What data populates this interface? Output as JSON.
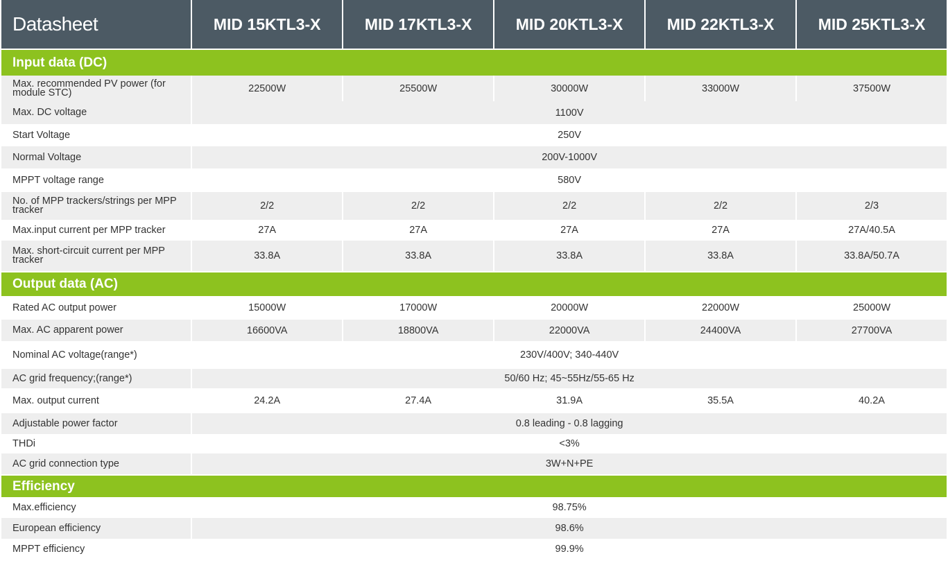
{
  "header": {
    "title": "Datasheet",
    "models": [
      "MID 15KTL3-X",
      "MID 17KTL3-X",
      "MID 20KTL3-X",
      "MID 22KTL3-X",
      "MID 25KTL3-X"
    ]
  },
  "sections": {
    "input": {
      "title": "Input data (DC)",
      "rows": {
        "r1": {
          "label": "Max. recommended PV power (for module STC)",
          "values": [
            "22500W",
            "25500W",
            "30000W",
            "33000W",
            "37500W"
          ]
        },
        "r2": {
          "label": "Max. DC voltage",
          "value": "1100V"
        },
        "r3": {
          "label": "Start Voltage",
          "value": "250V"
        },
        "r4": {
          "label": "Normal Voltage",
          "value": "200V-1000V"
        },
        "r5": {
          "label": "MPPT voltage range",
          "value": "580V"
        },
        "r6": {
          "label": "No. of MPP trackers/strings per MPP tracker",
          "values": [
            "2/2",
            "2/2",
            "2/2",
            "2/2",
            "2/3"
          ]
        },
        "r7": {
          "label": "Max.input current per MPP tracker",
          "values": [
            "27A",
            "27A",
            "27A",
            "27A",
            "27A/40.5A"
          ]
        },
        "r8": {
          "label": "Max. short-circuit current per MPP tracker",
          "values": [
            "33.8A",
            "33.8A",
            "33.8A",
            "33.8A",
            "33.8A/50.7A"
          ]
        }
      }
    },
    "output": {
      "title": "Output data (AC)",
      "rows": {
        "r1": {
          "label": "Rated AC output power",
          "values": [
            "15000W",
            "17000W",
            "20000W",
            "22000W",
            "25000W"
          ]
        },
        "r2": {
          "label": "Max. AC apparent power",
          "values": [
            "16600VA",
            "18800VA",
            "22000VA",
            "24400VA",
            "27700VA"
          ]
        },
        "r3": {
          "label": "Nominal AC voltage(range*)",
          "value": "230V/400V; 340-440V"
        },
        "r4": {
          "label": "AC grid frequency;(range*)",
          "value": "50/60 Hz; 45~55Hz/55-65 Hz"
        },
        "r5": {
          "label": "Max. output current",
          "values": [
            "24.2A",
            "27.4A",
            "31.9A",
            "35.5A",
            "40.2A"
          ]
        },
        "r6": {
          "label": "Adjustable power factor",
          "value": "0.8 leading - 0.8 lagging"
        },
        "r7": {
          "label": "THDi",
          "value": "<3%"
        },
        "r8": {
          "label": "AC grid connection type",
          "value": "3W+N+PE"
        }
      }
    },
    "efficiency": {
      "title": "Efficiency",
      "rows": {
        "r1": {
          "label": "Max.efficiency",
          "value": "98.75%"
        },
        "r2": {
          "label": "European efficiency",
          "value": "98.6%"
        },
        "r3": {
          "label": "MPPT efficiency",
          "value": "99.9%"
        }
      }
    }
  }
}
